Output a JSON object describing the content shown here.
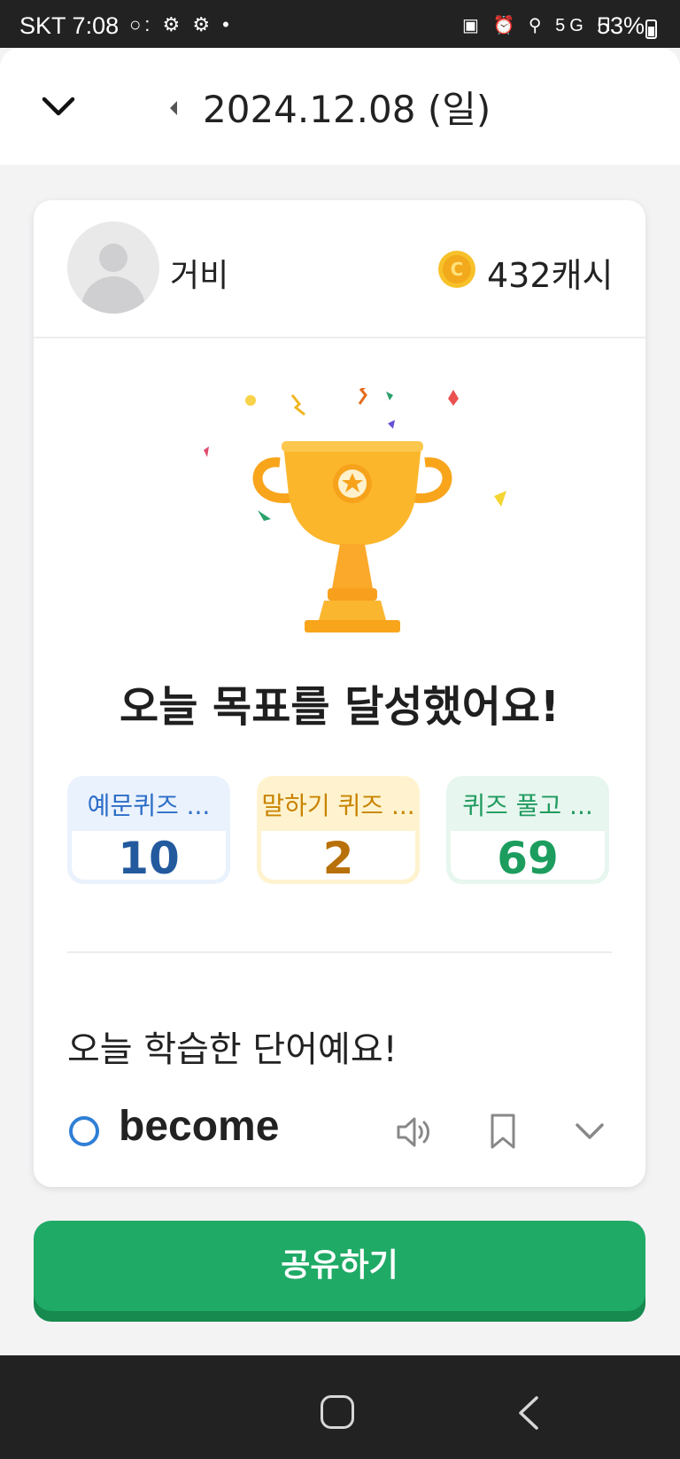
{
  "status_bar": {
    "carrier": "SKT",
    "time": "7:08",
    "battery": "53%",
    "network": "5G"
  },
  "header": {
    "date": "2024.12.08 (일)",
    "icons": [
      "chevron-down-icon",
      "caret-left-icon"
    ]
  },
  "profile": {
    "name": "거비",
    "cash": "432캐시",
    "coin_color": "#f5b800"
  },
  "achievement": {
    "headline": "오늘 목표를 달성했어요!"
  },
  "stats": [
    {
      "label": "예문퀴즈 ...",
      "value": "10",
      "color": "#235a9e"
    },
    {
      "label": "말하기 퀴즈 ...",
      "value": "2",
      "color": "#b8700a"
    },
    {
      "label": "퀴즈 풀고 ...",
      "value": "69",
      "color": "#1c9d5e"
    }
  ],
  "words": {
    "title": "오늘 학습한 단어예요!",
    "items": [
      {
        "word": "become",
        "icons": [
          "speaker-icon",
          "bookmark-icon",
          "chevron-down-icon"
        ]
      }
    ]
  },
  "share": {
    "label": "공유하기",
    "color": "#1faa66"
  }
}
